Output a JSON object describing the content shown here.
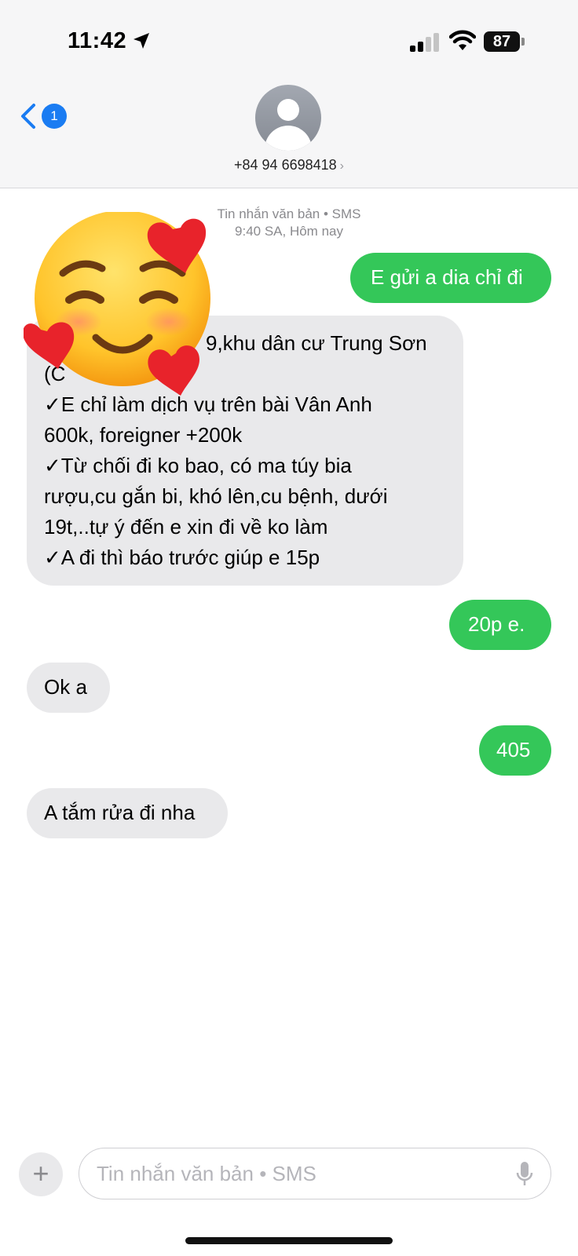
{
  "status_bar": {
    "time": "11:42",
    "battery": "87",
    "icons": [
      "location-arrow-icon",
      "cellular-signal-icon",
      "wifi-icon",
      "battery-icon"
    ]
  },
  "header": {
    "back_badge": "1",
    "contact": "+84 94 6698418",
    "contact_chevron": "›",
    "avatar_icon": "person-silhouette-icon"
  },
  "thread": {
    "meta_line1": "Tin nhắn văn bản • SMS",
    "meta_line2": "9:40 SA, Hôm nay",
    "messages": [
      {
        "direction": "out",
        "text": "E gửi a dia chỉ đi"
      },
      {
        "direction": "in",
        "lines": [
          "9,khu dân cư Trung Sơn",
          "(C",
          "✓E chỉ làm dịch vụ trên bài Vân Anh",
          "600k, foreigner +200k",
          "✓Từ chối đi ko bao, có ma túy bia",
          "rượu,cu gắn bi, khó lên,cu bệnh, dưới",
          "19t,..tự ý đến e xin đi về ko làm",
          "✓A đi thì báo trước giúp e 15p"
        ]
      },
      {
        "direction": "out",
        "text": "20p e."
      },
      {
        "direction": "in",
        "text": "Ok a"
      },
      {
        "direction": "out",
        "text": "405"
      },
      {
        "direction": "in",
        "text": "A tắm rửa đi nha"
      }
    ],
    "sticker": "smiling-face-with-hearts-emoji"
  },
  "compose": {
    "plus_label": "+",
    "placeholder": "Tin nhắn văn bản • SMS",
    "value": ""
  },
  "colors": {
    "outgoing_bubble": "#34c759",
    "incoming_bubble": "#e9e9eb",
    "accent": "#1a7cf2"
  }
}
